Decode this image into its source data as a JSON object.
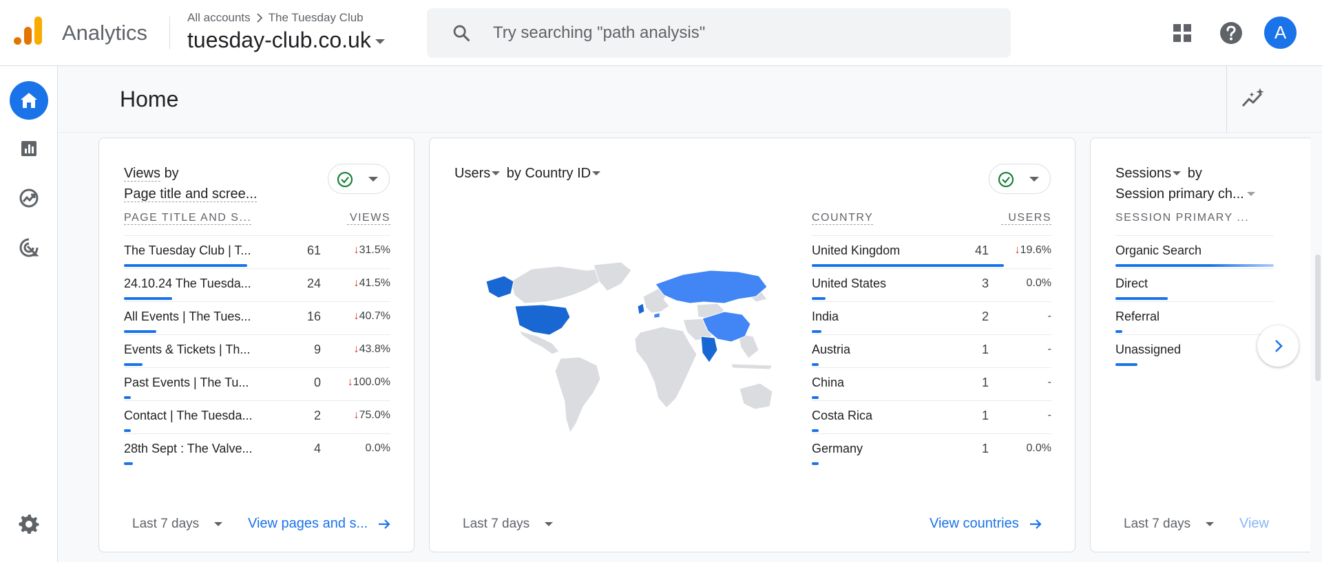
{
  "header": {
    "app_name": "Analytics",
    "breadcrumb": {
      "account": "All accounts",
      "separator": ">",
      "property": "The Tuesday Club"
    },
    "property_name": "tuesday-club.co.uk",
    "search_placeholder": "Try searching \"path analysis\"",
    "avatar_letter": "A",
    "icons": [
      "search-icon",
      "apps-grid-icon",
      "help-icon"
    ]
  },
  "nav": {
    "items": [
      "home-icon",
      "reports-icon",
      "explore-icon",
      "advertising-icon"
    ],
    "settings": "gear-icon"
  },
  "page": {
    "title": "Home"
  },
  "colors": {
    "accent": "#1a73e8",
    "decrease": "#d93025",
    "success": "#188038",
    "map_dark": "#1967d2",
    "map_light": "#4285f4",
    "map_land": "#dadce0"
  },
  "views_card": {
    "title_metric": "Views",
    "title_by": "by",
    "title_dimension": "Page title and scree...",
    "col_dimension": "PAGE TITLE AND S...",
    "col_metric": "VIEWS",
    "rows": [
      {
        "label": "The Tuesday Club | T...",
        "value": "61",
        "change": "31.5%",
        "direction": "down",
        "share": 1.0
      },
      {
        "label": "24.10.24 The Tuesda...",
        "value": "24",
        "change": "41.5%",
        "direction": "down",
        "share": 0.39
      },
      {
        "label": "All Events | The Tues...",
        "value": "16",
        "change": "40.7%",
        "direction": "down",
        "share": 0.26
      },
      {
        "label": "Events & Tickets | Th...",
        "value": "9",
        "change": "43.8%",
        "direction": "down",
        "share": 0.15
      },
      {
        "label": "Past Events | The Tu...",
        "value": "0",
        "change": "100.0%",
        "direction": "down",
        "share": 0.0
      },
      {
        "label": "Contact | The Tuesda...",
        "value": "2",
        "change": "75.0%",
        "direction": "down",
        "share": 0.03
      },
      {
        "label": "28th Sept : The Valve...",
        "value": "4",
        "change": "0.0%",
        "direction": "flat",
        "share": 0.07
      }
    ],
    "date_range": "Last 7 days",
    "link": "View pages and s..."
  },
  "country_card": {
    "title_metric": "Users",
    "title_by": "by",
    "title_dimension": "Country ID",
    "col_dimension": "COUNTRY",
    "col_metric": "USERS",
    "rows": [
      {
        "label": "United Kingdom",
        "value": "41",
        "change": "19.6%",
        "direction": "down",
        "share": 1.0
      },
      {
        "label": "United States",
        "value": "3",
        "change": "0.0%",
        "direction": "flat",
        "share": 0.07
      },
      {
        "label": "India",
        "value": "2",
        "change": "-",
        "direction": "none",
        "share": 0.05
      },
      {
        "label": "Austria",
        "value": "1",
        "change": "-",
        "direction": "none",
        "share": 0.02
      },
      {
        "label": "China",
        "value": "1",
        "change": "-",
        "direction": "none",
        "share": 0.02
      },
      {
        "label": "Costa Rica",
        "value": "1",
        "change": "-",
        "direction": "none",
        "share": 0.02
      },
      {
        "label": "Germany",
        "value": "1",
        "change": "0.0%",
        "direction": "flat",
        "share": 0.02
      }
    ],
    "date_range": "Last 7 days",
    "link": "View countries"
  },
  "sessions_card": {
    "title_metric": "Sessions",
    "title_by": "by",
    "title_dimension": "Session primary ch...",
    "col_dimension": "SESSION PRIMARY ...",
    "rows": [
      {
        "label": "Organic Search",
        "share": 1.0
      },
      {
        "label": "Direct",
        "share": 0.33
      },
      {
        "label": "Referral",
        "share": 0.04
      },
      {
        "label": "Unassigned",
        "share": 0.14
      }
    ],
    "date_range": "Last 7 days",
    "link": "View"
  }
}
